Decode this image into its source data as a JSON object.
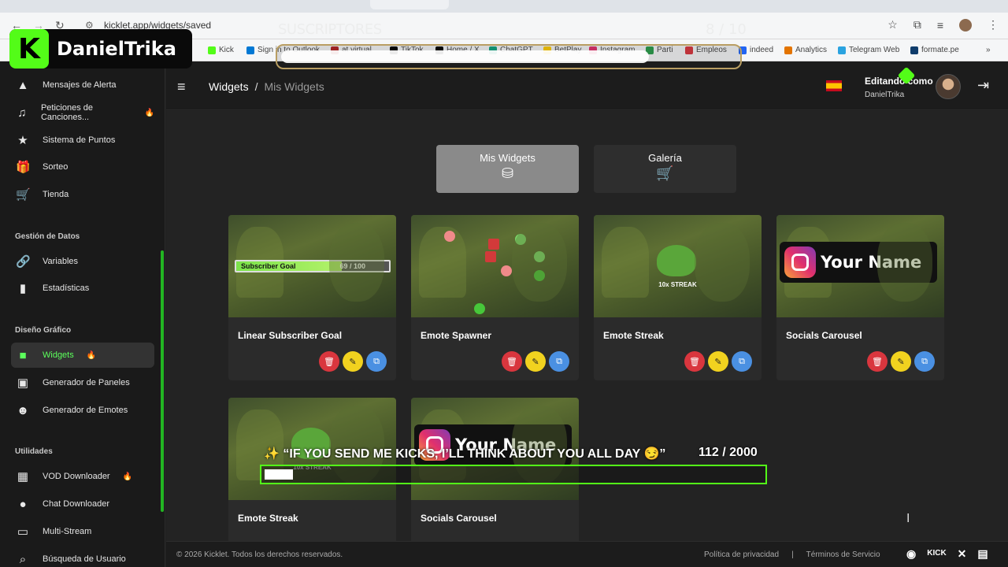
{
  "browser": {
    "url": "kicklet.app/widgets/saved",
    "bookmarks": [
      "Kick",
      "Sign in to Outlook",
      "at virtual",
      "TikTok",
      "Home / X",
      "ChatGPT",
      "BetPlay",
      "Instagram",
      "Parti",
      "Empleos",
      "indeed",
      "Analytics",
      "Telegram Web",
      "formate.pe"
    ],
    "bookmark_colors": [
      "#53fc18",
      "#0078d4",
      "#b22222",
      "#000000",
      "#000000",
      "#10a37f",
      "#ffcc00",
      "#e1306c",
      "#2a9d4a",
      "#d9363e",
      "#2164f3",
      "#e37400",
      "#2aa3e0",
      "#0f3c6b"
    ]
  },
  "sidebar": {
    "items_top": [
      {
        "label": "Mensajes de Alerta",
        "icon": "warning-icon"
      },
      {
        "label": "Peticiones de Canciones...",
        "icon": "music-icon"
      },
      {
        "label": "Sistema de Puntos",
        "icon": "star-icon"
      },
      {
        "label": "Sorteo",
        "icon": "gift-icon"
      },
      {
        "label": "Tienda",
        "icon": "cart-icon"
      }
    ],
    "section_datos": "Gestión de Datos",
    "items_datos": [
      {
        "label": "Variables",
        "icon": "link-icon"
      },
      {
        "label": "Estadísticas",
        "icon": "bar-chart-icon"
      }
    ],
    "section_diseno": "Diseño Gráfico",
    "items_diseno": [
      {
        "label": "Widgets",
        "icon": "video-icon",
        "active": true
      },
      {
        "label": "Generador de Paneles",
        "icon": "panel-icon"
      },
      {
        "label": "Generador de Emotes",
        "icon": "smile-icon"
      }
    ],
    "section_utilidades": "Utilidades",
    "items_util": [
      {
        "label": "VOD Downloader",
        "icon": "film-icon"
      },
      {
        "label": "Chat Downloader",
        "icon": "chat-icon"
      },
      {
        "label": "Multi-Stream",
        "icon": "monitor-icon"
      },
      {
        "label": "Búsqueda de Usuario",
        "icon": "search-icon"
      }
    ]
  },
  "header": {
    "breadcrumb_root": "Widgets",
    "breadcrumb_sep": "/",
    "breadcrumb_current": "Mis Widgets",
    "user_line1": "Editando como",
    "user_line2": "DanielTrika"
  },
  "tabs": {
    "mis": "Mis Widgets",
    "galeria": "Galería"
  },
  "cards": [
    {
      "title": "Linear Subscriber Goal",
      "preview_label": "Subscriber Goal",
      "preview_value": "69 / 100",
      "progress": 0.69
    },
    {
      "title": "Emote Spawner"
    },
    {
      "title": "Emote Streak",
      "streak": "10x STREAK"
    },
    {
      "title": "Socials Carousel",
      "social_name": "Your Name"
    },
    {
      "title": "Emote Streak",
      "streak": "10x STREAK"
    },
    {
      "title": "Socials Carousel",
      "social_name": "Your Name"
    }
  ],
  "footer": {
    "copyright": "© 2026 Kicklet. Todos los derechos reservados.",
    "privacy": "Política de privacidad",
    "sep": "|",
    "terms": "Términos de Servicio",
    "kick": "KICK"
  },
  "overlays": {
    "logo_letter": "K",
    "channel_name": "DanielTrika",
    "subs_title": "SUSCRIPTORES",
    "subs_count": "8 / 10",
    "subs_progress": 0.8,
    "goal_text": "✨ “IF YOU SEND ME KICKS, I’LL THINK ABOUT YOU ALL DAY 😏”",
    "goal_count": "112  / 2000",
    "goal_progress": 0.056
  }
}
